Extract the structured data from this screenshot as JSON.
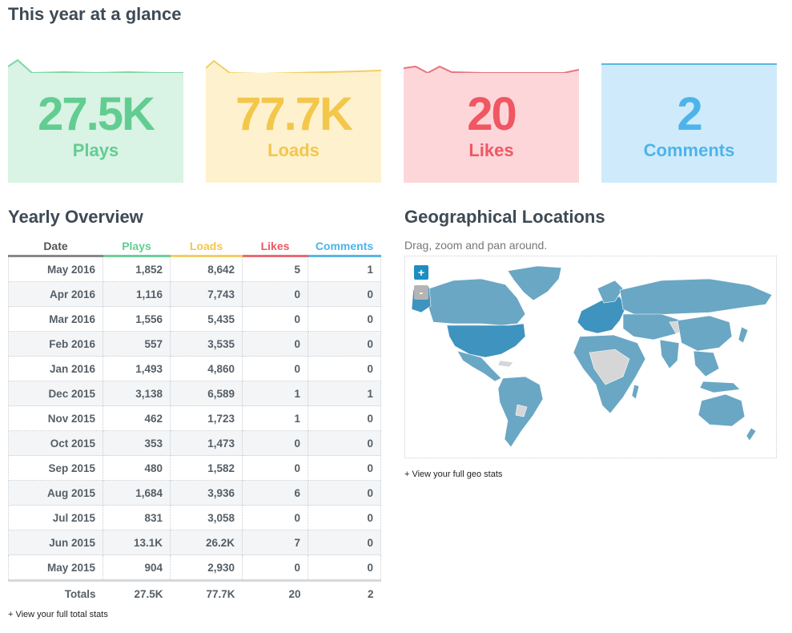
{
  "page": {
    "title": "This year at a glance"
  },
  "cards": [
    {
      "value": "27.5K",
      "label": "Plays",
      "color": "#62cd91",
      "bg": "#d9f3e5",
      "line": "#7fd6a6"
    },
    {
      "value": "77.7K",
      "label": "Loads",
      "color": "#f3c64c",
      "bg": "#fef1cd",
      "line": "#f2cf63"
    },
    {
      "value": "20",
      "label": "Likes",
      "color": "#ef5763",
      "bg": "#fdd6d9",
      "line": "#e7737b"
    },
    {
      "value": "2",
      "label": "Comments",
      "color": "#4db4ea",
      "bg": "#cfebfb",
      "line": "#5ab7e2"
    }
  ],
  "yearly": {
    "title": "Yearly Overview",
    "headers": {
      "date": "Date",
      "plays": "Plays",
      "loads": "Loads",
      "likes": "Likes",
      "comments": "Comments"
    },
    "rows": [
      [
        "May 2016",
        "1,852",
        "8,642",
        "5",
        "1"
      ],
      [
        "Apr 2016",
        "1,116",
        "7,743",
        "0",
        "0"
      ],
      [
        "Mar 2016",
        "1,556",
        "5,435",
        "0",
        "0"
      ],
      [
        "Feb 2016",
        "557",
        "3,535",
        "0",
        "0"
      ],
      [
        "Jan 2016",
        "1,493",
        "4,860",
        "0",
        "0"
      ],
      [
        "Dec 2015",
        "3,138",
        "6,589",
        "1",
        "1"
      ],
      [
        "Nov 2015",
        "462",
        "1,723",
        "1",
        "0"
      ],
      [
        "Oct 2015",
        "353",
        "1,473",
        "0",
        "0"
      ],
      [
        "Sep 2015",
        "480",
        "1,582",
        "0",
        "0"
      ],
      [
        "Aug 2015",
        "1,684",
        "3,936",
        "6",
        "0"
      ],
      [
        "Jul 2015",
        "831",
        "3,058",
        "0",
        "0"
      ],
      [
        "Jun 2015",
        "13.1K",
        "26.2K",
        "7",
        "0"
      ],
      [
        "May 2015",
        "904",
        "2,930",
        "0",
        "0"
      ]
    ],
    "totals": [
      "Totals",
      "27.5K",
      "77.7K",
      "20",
      "2"
    ],
    "link": "+ View your full total stats"
  },
  "geo": {
    "title": "Geographical Locations",
    "subtitle": "Drag, zoom and pan around.",
    "zoom_in": "+",
    "zoom_out": "-",
    "link": "+ View your full geo stats",
    "land_color": "#6aa7c4",
    "us_color": "#3f93bf",
    "nodata_color": "#d6d6d6"
  }
}
